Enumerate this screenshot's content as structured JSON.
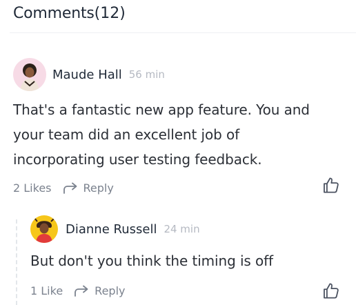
{
  "header": {
    "title": "Comments",
    "count": "(12)"
  },
  "comments": [
    {
      "author": "Maude Hall",
      "time": "56 min",
      "lines": [
        "That's a fantastic new app feature. You and",
        "your team did an excellent job of",
        "incorporating user testing feedback."
      ],
      "likes": "2 Likes",
      "reply_label": "Reply"
    },
    {
      "author": "Dianne Russell",
      "time": "24 min",
      "lines": [
        "But don't you think the timing is off"
      ],
      "likes": "1 Like",
      "reply_label": "Reply"
    }
  ],
  "colors": {
    "text": "#1f2937",
    "muted": "#7b828e",
    "time": "#b5b9c2",
    "avatar_pink": "#f7dbe6",
    "avatar_yellow": "#f6c61a"
  },
  "icons": {
    "reply": "reply-arrow-icon",
    "like": "thumbs-up-icon"
  }
}
